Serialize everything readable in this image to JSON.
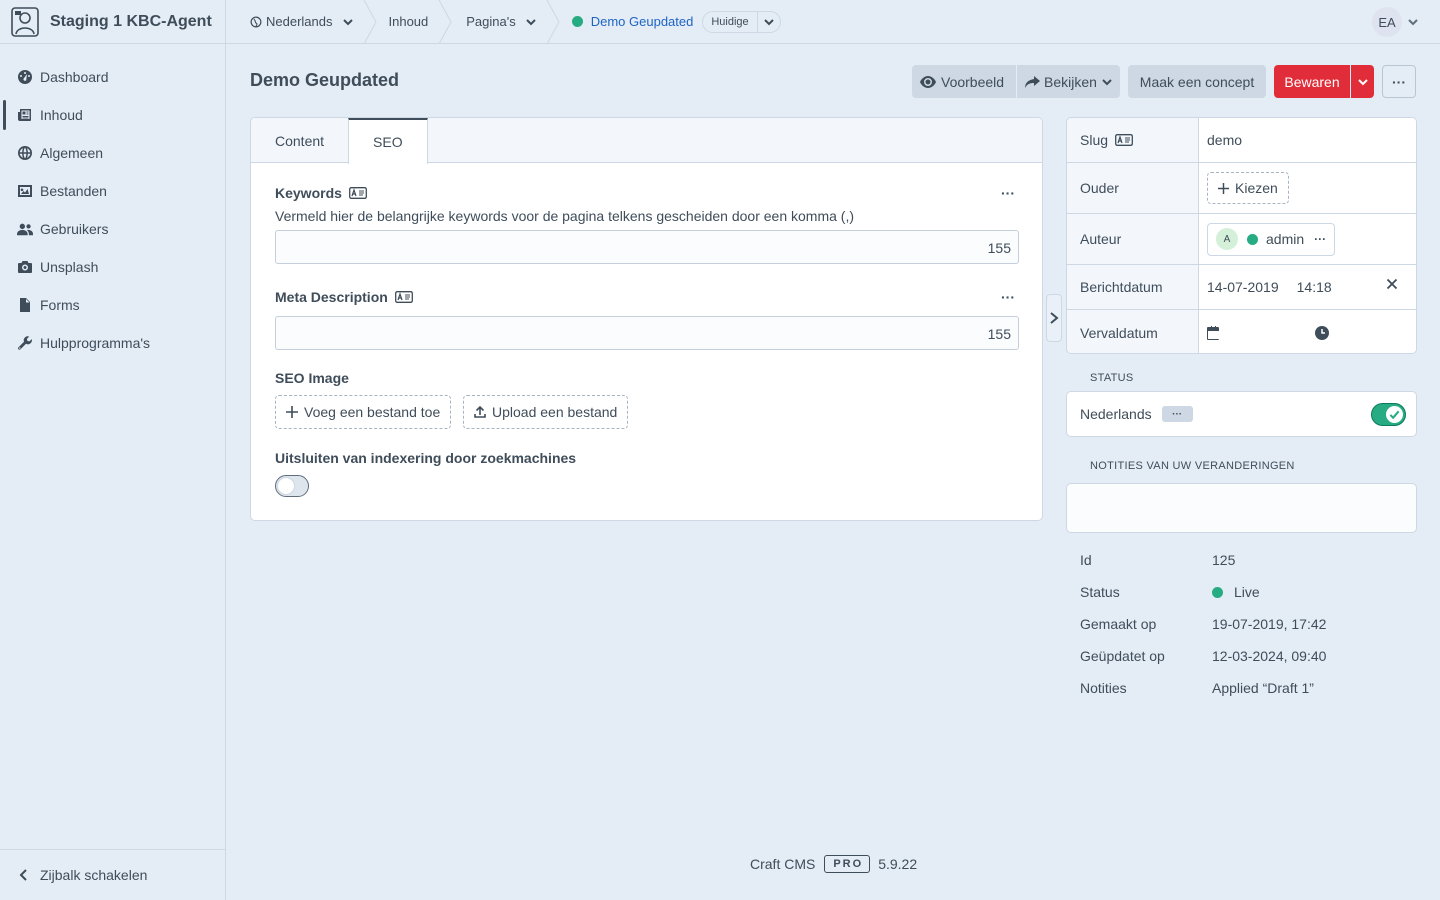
{
  "site": {
    "name": "Staging 1 KBC-Agent"
  },
  "nav": {
    "items": [
      {
        "label": "Dashboard",
        "icon": "gauge-icon"
      },
      {
        "label": "Inhoud",
        "icon": "newspaper-icon"
      },
      {
        "label": "Algemeen",
        "icon": "globe-icon"
      },
      {
        "label": "Bestanden",
        "icon": "image-icon"
      },
      {
        "label": "Gebruikers",
        "icon": "users-icon"
      },
      {
        "label": "Unsplash",
        "icon": "camera-icon"
      },
      {
        "label": "Forms",
        "icon": "file-icon"
      },
      {
        "label": "Hulpprogramma's",
        "icon": "wrench-icon"
      }
    ],
    "toggle_label": "Zijbalk schakelen"
  },
  "header": {
    "site_selector": "Nederlands",
    "crumb_section": "Inhoud",
    "crumb_type": "Pagina's",
    "entry_title": "Demo Geupdated",
    "revision_label": "Huidige",
    "user_initials": "EA"
  },
  "page": {
    "title": "Demo Geupdated"
  },
  "toolbar": {
    "preview_label": "Voorbeeld",
    "view_label": "Bekijken",
    "draft_label": "Maak een concept",
    "save_label": "Bewaren",
    "more_label": "···"
  },
  "tabs": [
    {
      "label": "Content",
      "active": false
    },
    {
      "label": "SEO",
      "active": true
    }
  ],
  "fields": {
    "keywords": {
      "label": "Keywords",
      "instructions": "Vermeld hier de belangrijke keywords voor de pagina telkens gescheiden door een komma (,)",
      "value": "",
      "remaining": "155"
    },
    "meta_description": {
      "label": "Meta Description",
      "value": "",
      "remaining": "155"
    },
    "seo_image": {
      "label": "SEO Image",
      "add_label": "Voeg een bestand toe",
      "upload_label": "Upload een bestand"
    },
    "noindex": {
      "label": "Uitsluiten van indexering door zoekmachines",
      "enabled": false
    },
    "dots": "···"
  },
  "meta": {
    "slug_label": "Slug",
    "slug_value": "demo",
    "parent_label": "Ouder",
    "parent_button": "Kiezen",
    "author_label": "Auteur",
    "author_initial": "A",
    "author_name": "admin",
    "post_date_label": "Berichtdatum",
    "post_date": "14-07-2019",
    "post_time": "14:18",
    "expiry_label": "Vervaldatum"
  },
  "status": {
    "section_label": "STATUS",
    "site_label": "Nederlands",
    "site_badge": "···",
    "enabled": true
  },
  "notes": {
    "section_label": "NOTITIES VAN UW VERANDERINGEN",
    "value": ""
  },
  "info": [
    {
      "label": "Id",
      "value": "125"
    },
    {
      "label": "Status",
      "value": "Live"
    },
    {
      "label": "Gemaakt op",
      "value": "19-07-2019, 17:42"
    },
    {
      "label": "Geüpdatet op",
      "value": "12-03-2024, 09:40"
    },
    {
      "label": "Notities",
      "value": "Applied “Draft 1”"
    }
  ],
  "footer": {
    "product": "Craft CMS",
    "edition": "PRO",
    "version": "5.9.22"
  },
  "colors": {
    "accent": "#1e63c4",
    "danger": "#e12d39",
    "live": "#27ab83",
    "background": "#e4edf6"
  }
}
